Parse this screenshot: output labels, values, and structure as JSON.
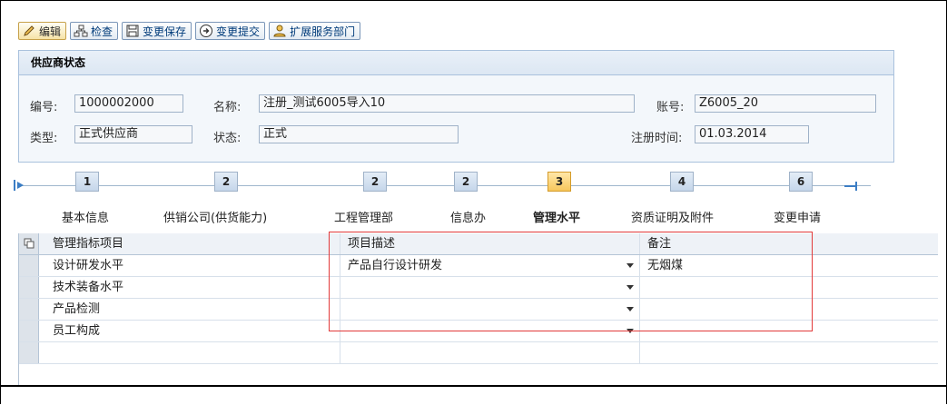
{
  "toolbar": {
    "edit": "编辑",
    "check": "检查",
    "save_change": "变更保存",
    "submit_change": "变更提交",
    "extend_dept": "扩展服务部门"
  },
  "supplier_status": {
    "title": "供应商状态",
    "number_label": "编号:",
    "number_value": "1000002000",
    "name_label": "名称:",
    "name_value": "注册_测试6005导入10",
    "account_label": "账号:",
    "account_value": "Z6005_20",
    "type_label": "类型:",
    "type_value": "正式供应商",
    "status_label": "状态:",
    "status_value": "正式",
    "reg_time_label": "注册时间:",
    "reg_time_value": "01.03.2014"
  },
  "roadmap": {
    "steps": [
      {
        "count": "1",
        "label": "基本信息",
        "active": false
      },
      {
        "count": "2",
        "label": "供销公司(供货能力)",
        "active": false
      },
      {
        "count": "2",
        "label": "工程管理部",
        "active": false
      },
      {
        "count": "2",
        "label": "信息办",
        "active": false
      },
      {
        "count": "3",
        "label": "管理水平",
        "active": true
      },
      {
        "count": "4",
        "label": "资质证明及附件",
        "active": false
      },
      {
        "count": "6",
        "label": "变更申请",
        "active": false
      }
    ]
  },
  "table": {
    "columns": [
      "管理指标项目",
      "项目描述",
      "备注"
    ],
    "rows": [
      {
        "item": "设计研发水平",
        "desc": "产品自行设计研发",
        "note": "无烟煤"
      },
      {
        "item": "技术装备水平",
        "desc": "",
        "note": ""
      },
      {
        "item": "产品检测",
        "desc": "",
        "note": ""
      },
      {
        "item": "员工构成",
        "desc": "",
        "note": ""
      }
    ]
  },
  "colors": {
    "highlight_box": "#e23a3a",
    "active_step": "#f7c75c",
    "panel_border": "#a9c1dd"
  }
}
